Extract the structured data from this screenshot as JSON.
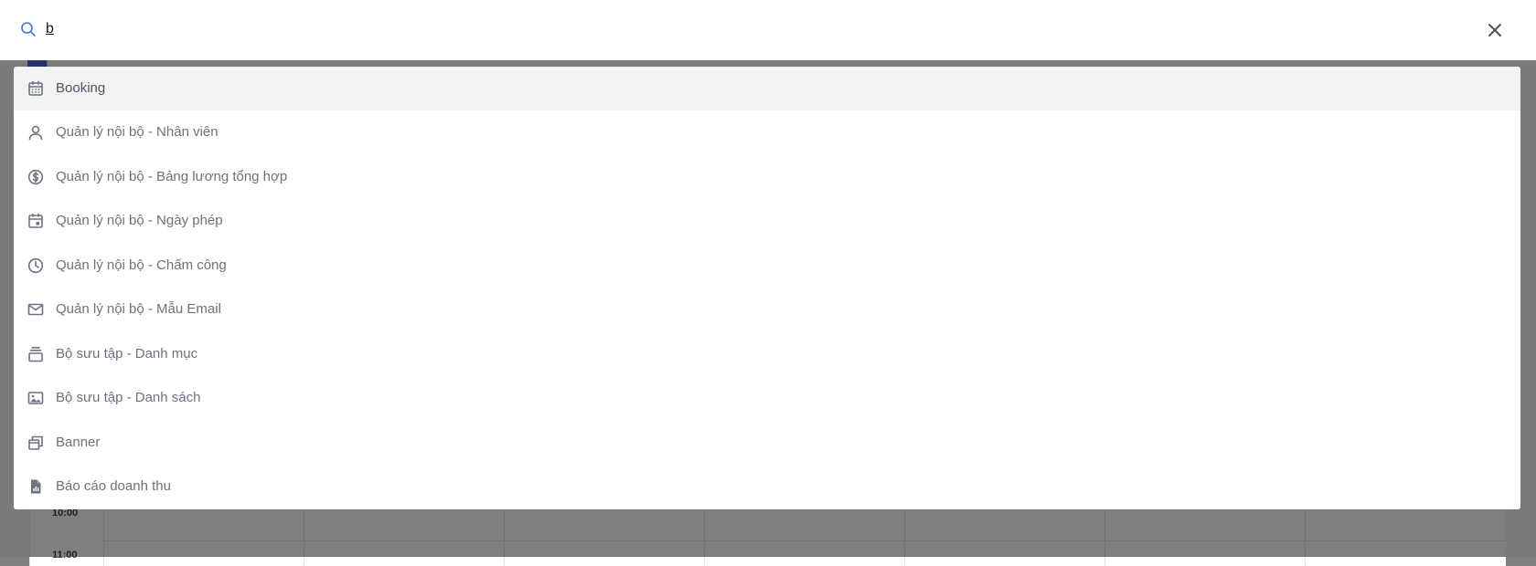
{
  "search": {
    "query": "b"
  },
  "results": [
    {
      "label": "Booking",
      "icon": "calendar-grid-icon",
      "active": true
    },
    {
      "label": "Quản lý nội bộ - Nhân viên",
      "icon": "user-icon"
    },
    {
      "label": "Quản lý nội bộ - Bảng lương tổng hợp",
      "icon": "dollar-circle-icon"
    },
    {
      "label": "Quản lý nội bộ - Ngày phép",
      "icon": "calendar-day-icon"
    },
    {
      "label": "Quản lý nội bộ - Chấm công",
      "icon": "clock-icon"
    },
    {
      "label": "Quản lý nội bộ - Mẫu Email",
      "icon": "mail-icon"
    },
    {
      "label": "Bộ sưu tập - Danh mục",
      "icon": "stack-icon"
    },
    {
      "label": "Bộ sưu tập - Danh sách",
      "icon": "image-icon"
    },
    {
      "label": "Banner",
      "icon": "windows-icon"
    },
    {
      "label": "Báo cáo doanh thu",
      "icon": "report-file-icon"
    }
  ],
  "background": {
    "times": [
      "10:00",
      "11:00"
    ]
  },
  "colors": {
    "accent": "#4a6bd6",
    "overlay": "rgba(0,0,0,0.5)",
    "active_row": "#f2f3f3",
    "icon": "#6b7280"
  }
}
